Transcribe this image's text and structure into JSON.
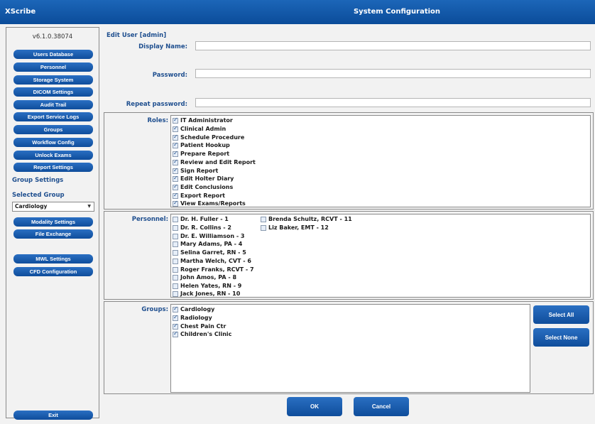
{
  "window": {
    "app_name": "XScribe",
    "title": "System Configuration"
  },
  "sidebar": {
    "version": "v6.1.0.38074",
    "nav": [
      "Users Database",
      "Personnel",
      "Storage System",
      "DICOM Settings",
      "Audit Trail",
      "Export Service Logs",
      "Groups",
      "Workflow Config",
      "Unlock Exams",
      "Report Settings"
    ],
    "group_settings_label": "Group Settings",
    "selected_group_label": "Selected Group",
    "selected_group_value": "Cardiology",
    "group_nav": [
      "Modality Settings",
      "File Exchange"
    ],
    "extra_nav": [
      "MWL Settings",
      "CFD Configuration"
    ],
    "exit_label": "Exit"
  },
  "form": {
    "heading": "Edit User [admin]",
    "display_name_label": "Display Name:",
    "display_name_value": "",
    "password_label": "Password:",
    "password_value": "",
    "repeat_password_label": "Repeat password:",
    "repeat_password_value": ""
  },
  "roles": {
    "label": "Roles:",
    "items": [
      {
        "label": "IT Administrator",
        "checked": true
      },
      {
        "label": "Clinical Admin",
        "checked": true
      },
      {
        "label": "Schedule Procedure",
        "checked": true
      },
      {
        "label": "Patient Hookup",
        "checked": true
      },
      {
        "label": "Prepare Report",
        "checked": true
      },
      {
        "label": "Review and Edit Report",
        "checked": true
      },
      {
        "label": "Sign Report",
        "checked": true
      },
      {
        "label": "Edit Holter Diary",
        "checked": true
      },
      {
        "label": "Edit Conclusions",
        "checked": true
      },
      {
        "label": "Export Report",
        "checked": true
      },
      {
        "label": "View Exams/Reports",
        "checked": true
      }
    ]
  },
  "personnel": {
    "label": "Personnel:",
    "col1": [
      {
        "label": "Dr. H. Fuller - 1",
        "checked": false
      },
      {
        "label": "Dr. R. Collins - 2",
        "checked": false
      },
      {
        "label": "Dr. E. Williamson - 3",
        "checked": false
      },
      {
        "label": "Mary Adams, PA - 4",
        "checked": false
      },
      {
        "label": "Selina Garret, RN - 5",
        "checked": false
      },
      {
        "label": "Martha Welch, CVT - 6",
        "checked": false
      },
      {
        "label": "Roger Franks, RCVT - 7",
        "checked": false
      },
      {
        "label": "John Amos, PA - 8",
        "checked": false
      },
      {
        "label": "Helen Yates, RN - 9",
        "checked": false
      },
      {
        "label": "Jack Jones, RN - 10",
        "checked": false
      }
    ],
    "col2": [
      {
        "label": "Brenda Schultz, RCVT - 11",
        "checked": false
      },
      {
        "label": "Liz Baker, EMT - 12",
        "checked": false
      }
    ]
  },
  "groups": {
    "label": "Groups:",
    "items": [
      {
        "label": "Cardiology",
        "checked": true
      },
      {
        "label": "Radiology",
        "checked": true
      },
      {
        "label": "Chest Pain Ctr",
        "checked": true
      },
      {
        "label": "Children's Clinic",
        "checked": true
      }
    ],
    "select_all_label": "Select All",
    "select_none_label": "Select None"
  },
  "actions": {
    "ok_label": "OK",
    "cancel_label": "Cancel"
  },
  "colors": {
    "title_bar": "#0b4c9a",
    "button": "#0f4d9b",
    "label": "#1f4f8f"
  }
}
